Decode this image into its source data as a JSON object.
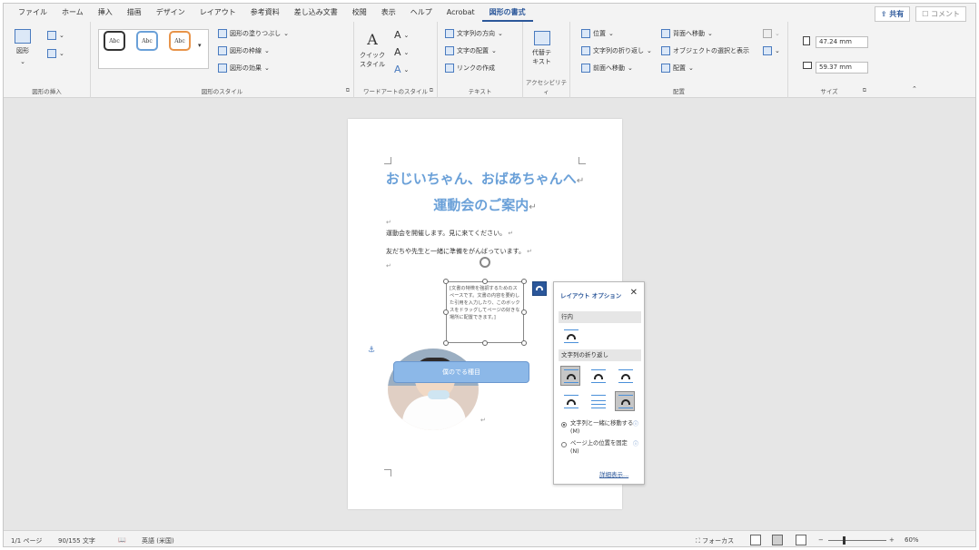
{
  "tabs": [
    "ファイル",
    "ホーム",
    "挿入",
    "描画",
    "デザイン",
    "レイアウト",
    "参考資料",
    "差し込み文書",
    "校閲",
    "表示",
    "ヘルプ",
    "Acrobat",
    "図形の書式"
  ],
  "active_tab": "図形の書式",
  "share_label": "共有",
  "comment_label": "コメント",
  "ribbon": {
    "insert_shapes": {
      "shape_label": "図形",
      "group_label": "図形の挿入"
    },
    "shape_styles": {
      "style_samples": [
        "Abc",
        "Abc",
        "Abc"
      ],
      "fill": "図形の塗りつぶし",
      "outline": "図形の枠線",
      "effects": "図形の効果",
      "group_label": "図形のスタイル"
    },
    "wordart": {
      "quick_styles": "クイック\nスタイル",
      "group_label": "ワードアートのスタイル"
    },
    "text": {
      "direction": "文字列の方向",
      "align": "文字の配置",
      "link": "リンクの作成",
      "group_label": "テキスト"
    },
    "accessibility": {
      "alt_text": "代替テ\nキスト",
      "group_label": "アクセシビリティ"
    },
    "arrange": {
      "position": "位置",
      "wrap": "文字列の折り返し",
      "bring_forward": "前面へ移動",
      "send_backward": "背面へ移動",
      "selection_pane": "オブジェクトの選択と表示",
      "align": "配置",
      "group_label": "配置"
    },
    "size": {
      "height": "47.24 mm",
      "width": "59.37 mm",
      "group_label": "サイズ"
    }
  },
  "document": {
    "title_line1": "おじいちゃん、おばあちゃんへ",
    "title_line2": "運動会のご案内",
    "body_line1": "運動会を開催します。見に来てください。",
    "body_line2": "友だちや先生と一緒に準備をがんばっています。",
    "textbox_text": "[文書の特徴を強調するためのスペースです。文書の内容を要約した引用を入力したり、このボックスをドラッグしてページの好きな場所に配置できます。]",
    "banner_text": "僕のでる種目"
  },
  "layout_pane": {
    "title": "レイアウト オプション",
    "close": "✕",
    "inline_section": "行内",
    "wrap_section": "文字列の折り返し",
    "option1": "文字列と一緒に移動する(M)",
    "option2": "ページ上の位置を固定(N)",
    "details_link": "詳細表示..."
  },
  "status": {
    "page": "1/1 ページ",
    "words": "90/155 文字",
    "language": "英語 (米国)",
    "focus": "フォーカス",
    "zoom": "60%"
  },
  "colors": {
    "accent": "#2b579a",
    "title_blue": "#6aa0d8"
  }
}
